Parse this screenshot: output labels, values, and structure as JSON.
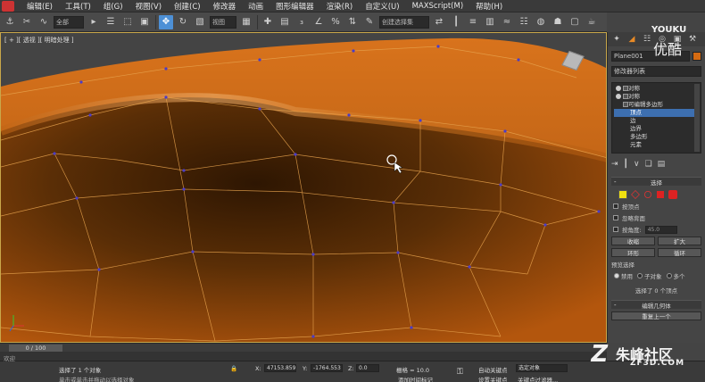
{
  "menu": [
    "编辑(E)",
    "工具(T)",
    "组(G)",
    "视图(V)",
    "创建(C)",
    "修改器",
    "动画",
    "图形编辑器",
    "渲染(R)",
    "自定义(U)",
    "MAXScript(M)",
    "帮助(H)"
  ],
  "toolbar": {
    "filter_label": "全部",
    "viewref_label": "视图",
    "selset_label": "创建选择集"
  },
  "viewport": {
    "label": "[ + ][ 透视 ][ 明暗处理 ]"
  },
  "panel": {
    "object_name": "Plane001",
    "modifier_list": "修改器列表",
    "stack": [
      {
        "label": "对称",
        "sub": false,
        "selected": false
      },
      {
        "label": "对称",
        "sub": false,
        "selected": false
      },
      {
        "label": "可编辑多边形",
        "sub": false,
        "selected": false
      },
      {
        "label": "顶点",
        "sub": true,
        "selected": true
      },
      {
        "label": "边",
        "sub": true,
        "selected": false
      },
      {
        "label": "边界",
        "sub": true,
        "selected": false
      },
      {
        "label": "多边形",
        "sub": true,
        "selected": false
      },
      {
        "label": "元素",
        "sub": true,
        "selected": false
      }
    ],
    "select_rollout": "选择",
    "by_vertex": "按顶点",
    "ignore_backfacing": "忽略背面",
    "by_angle": "按角度:",
    "angle_value": "45.0",
    "shrink": "收缩",
    "grow": "扩大",
    "ring": "环形",
    "loop": "循环",
    "preview_select": "预览选择",
    "disabled": "禁用",
    "subobject": "子对象",
    "multi": "多个",
    "select_status": "选择了 0 个顶点",
    "edit_geometry": "编辑几何体",
    "repeat_last": "重复上一个"
  },
  "timeline": {
    "frame_label": "0 / 100"
  },
  "status": {
    "welcome": "欢迎",
    "selected_text": "选择了 1 个对象",
    "hint_text": "单击或单击并拖动以选择对象",
    "x_label": "X:",
    "x_value": "47153.859",
    "y_label": "Y:",
    "y_value": "-1764.553",
    "z_label": "Z:",
    "z_value": "0.0",
    "grid_text": "栅格 = 10.0",
    "autokey_label": "自动关键点",
    "selected_obj": "选定对象",
    "setkey_label": "设置关键点",
    "keyfilter_label": "关键点过滤器...",
    "add_time_tag": "添加时间标记"
  },
  "watermarks": {
    "youku_top": "YOUKU",
    "youku_cn": "优酷",
    "brand_cn": "朱峰社区",
    "brand_url": "ZF3D.COM"
  }
}
